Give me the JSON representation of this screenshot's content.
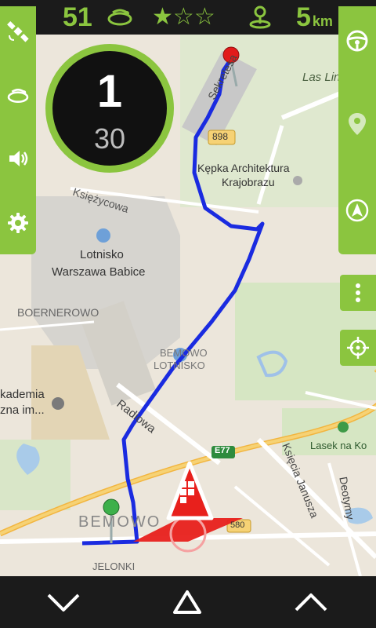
{
  "topbar": {
    "points": "51",
    "stars_total": 3,
    "stars_filled": 1,
    "distance_value": "5",
    "distance_unit": "km",
    "icons": [
      "lap-icon",
      "star-icon",
      "location-beacon-icon"
    ]
  },
  "counter": {
    "primary": "1",
    "secondary": "30"
  },
  "left_sidebar": {
    "buttons": [
      "satellite-icon",
      "lap-icon",
      "volume-icon",
      "settings-icon"
    ]
  },
  "right_sidebar": {
    "buttons": [
      "steering-wheel-icon",
      "location-pin-icon",
      "navigation-arrow-icon",
      "more-vertical-icon",
      "crosshair-icon"
    ]
  },
  "map": {
    "labels": {
      "sekretesa": "Sekretesa",
      "las_lin": "Las Lin",
      "road_898": "898",
      "kepka": "Kępka Architektura",
      "krajobrazu": "Krajobrazu",
      "ksiezycowa": "Księżycowa",
      "lotnisko": "Lotnisko",
      "babice": "Warszawa Babice",
      "boernerowo": "BOERNEROWO",
      "bemowo_lot1": "BEMOWO",
      "bemowo_lot2": "LOTNISKO",
      "akademia1": "kademia",
      "akademia2": "zna im...",
      "radiowa": "Radiowa",
      "e77": "E77",
      "ksiecia": "Księcia Janusza",
      "lasek": "Lasek na Ko",
      "deotymy": "Deotymy",
      "bemowo": "BEMOWO",
      "road_580": "580",
      "jelonki": "JELONKI"
    }
  },
  "bottombar": {
    "buttons": [
      "chevron-down-icon",
      "triangle-up-icon",
      "chevron-up-icon"
    ]
  },
  "colors": {
    "accent": "#8bc53f",
    "bar": "#1b1b1b",
    "route": "#1a2be0",
    "alert": "#e8201c"
  }
}
